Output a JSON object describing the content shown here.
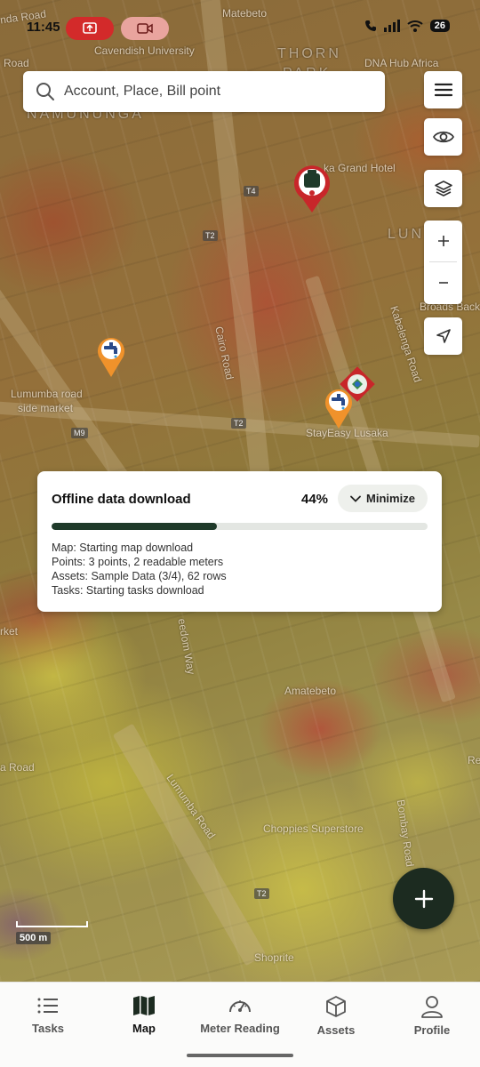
{
  "status_bar": {
    "time": "11:45",
    "battery": "26",
    "icons": [
      "screen-share-icon",
      "video-call-icon",
      "call-icon",
      "signal-icon",
      "wifi-icon",
      "battery-icon"
    ]
  },
  "search": {
    "placeholder": "Account, Place, Bill point"
  },
  "map": {
    "labels": {
      "matebeto": "Matebeto",
      "cavendish": "Cavendish University",
      "thorn": "THORN",
      "park": "PARK",
      "dna_hub": "DNA Hub Africa",
      "road_top_left": "nda Road",
      "road_left": "Road",
      "namununga": "NAMUNUNGA",
      "grand_hotel": "ka Grand Hotel",
      "lun": "LUN",
      "broads": "Broads Back",
      "kabelenga": "Kabelenga Road",
      "cairo": "Cairo Road",
      "lumumba_market_1": "Lumumba road",
      "lumumba_market_2": "side market",
      "stayeasy": "StayEasy Lusaka",
      "market_left": "rket",
      "freedom_way": "eedom Way",
      "amatebeto": "Amatebeto",
      "ka_road": "a Road",
      "lumumba_road": "Lumumba Road",
      "choppies": "Choppies Superstore",
      "bombay": "Bombay Road",
      "shoprite": "Shoprite",
      "re": "Re"
    },
    "road_tags": {
      "t4": "T4",
      "t2a": "T2",
      "t2b": "T2",
      "t2c": "T2",
      "m9": "M9"
    },
    "scale": "500 m"
  },
  "download_card": {
    "title": "Offline data download",
    "percent_label": "44%",
    "progress": 0.44,
    "minimize_label": "Minimize",
    "lines": [
      "Map: Starting map download",
      "Points: 3 points, 2 readable meters",
      "Assets: Sample Data (3/4), 62 rows",
      "Tasks: Starting tasks download"
    ]
  },
  "bottom_nav": {
    "items": [
      {
        "label": "Tasks",
        "icon": "list-icon"
      },
      {
        "label": "Map",
        "icon": "map-icon",
        "active": true
      },
      {
        "label": "Meter Reading",
        "icon": "gauge-icon"
      },
      {
        "label": "Assets",
        "icon": "cube-icon"
      },
      {
        "label": "Profile",
        "icon": "person-icon"
      }
    ]
  },
  "colors": {
    "primary_dark": "#1c2b20",
    "progress_fill": "#1f3a2a",
    "pin_orange": "#f0922b",
    "pin_red": "#c8262a",
    "status_pill_red": "#d32a2a"
  }
}
